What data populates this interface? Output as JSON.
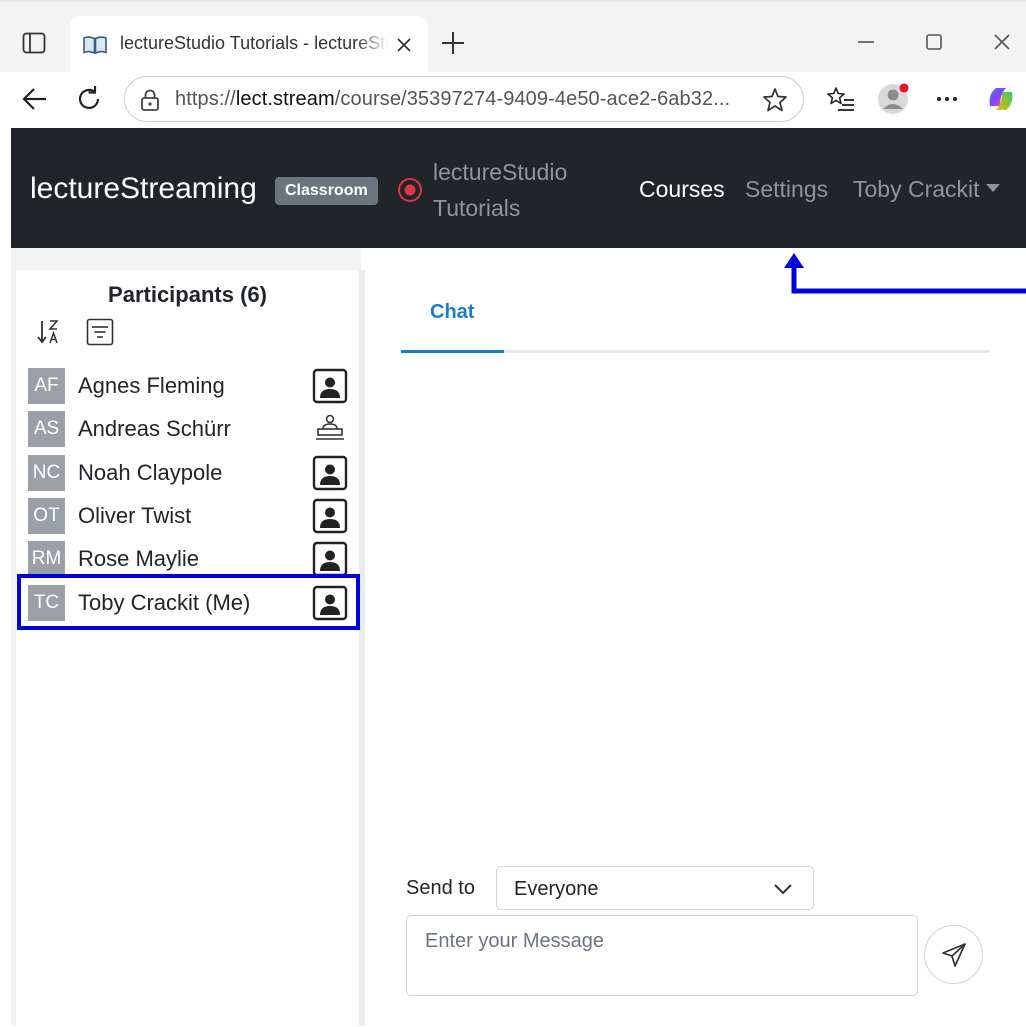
{
  "browser": {
    "tab_title": "lectureStudio Tutorials - lectureStudio",
    "url_prefix": "https://",
    "url_host": "lect.stream",
    "url_path": "/course/35397274-9409-4e50-ace2-6ab32..."
  },
  "navbar": {
    "brand": "lectureStreaming",
    "badge": "Classroom",
    "course_title": "lectureStudio Tutorials",
    "links": {
      "courses": "Courses",
      "settings": "Settings",
      "user": "Toby Crackit"
    }
  },
  "participants": {
    "title": "Participants (6)",
    "items": [
      {
        "initials": "AF",
        "name": "Agnes Fleming",
        "role": "participant-icon"
      },
      {
        "initials": "AS",
        "name": "Andreas Schürr",
        "role": "presenter-icon"
      },
      {
        "initials": "NC",
        "name": "Noah Claypole",
        "role": "participant-icon"
      },
      {
        "initials": "OT",
        "name": "Oliver Twist",
        "role": "participant-icon"
      },
      {
        "initials": "RM",
        "name": "Rose Maylie",
        "role": "participant-icon"
      },
      {
        "initials": "TC",
        "name": "Toby Crackit (Me)",
        "role": "participant-icon"
      }
    ]
  },
  "chat": {
    "tab_label": "Chat",
    "send_to_label": "Send to",
    "send_to_value": "Everyone",
    "message_placeholder": "Enter your Message"
  },
  "colors": {
    "navbar_bg": "#212529",
    "accent": "#1a7fc4",
    "annotation": "#0000dd",
    "badge_bg": "#6c757d",
    "record_red": "#dc3545"
  }
}
